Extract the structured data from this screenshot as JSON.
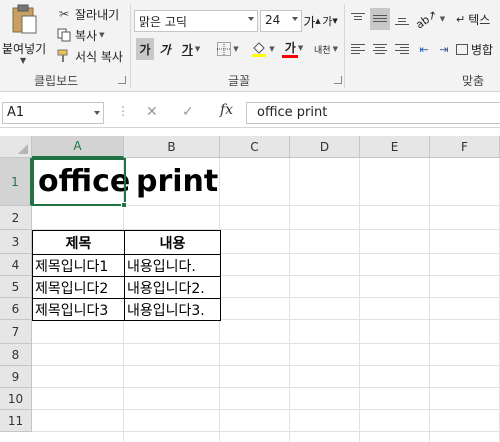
{
  "ribbon": {
    "clipboard": {
      "paste_label": "붙여넣기",
      "cut_label": "잘라내기",
      "copy_label": "복사",
      "format_painter_label": "서식 복사",
      "group_label": "클립보드"
    },
    "font": {
      "font_name": "맑은 고딕",
      "font_size": "24",
      "grow_label": "가",
      "shrink_label": "가",
      "bold_label": "가",
      "italic_label": "가",
      "underline_label": "가",
      "font_color_label": "가",
      "phonetic_label": "내천",
      "group_label": "글꼴",
      "fill_color": "#ffff00",
      "font_color": "#ff0000"
    },
    "alignment": {
      "group_label": "맞춤",
      "wrap_label": "텍스",
      "merge_label": "병합"
    }
  },
  "formula_bar": {
    "name_box": "A1",
    "fx_label": "fx",
    "value": "office print"
  },
  "sheet": {
    "columns": [
      "A",
      "B",
      "C",
      "D",
      "E",
      "F"
    ],
    "rows": [
      "1",
      "2",
      "3",
      "4",
      "5",
      "6",
      "7",
      "8",
      "9",
      "10",
      "11"
    ],
    "selected_cell": "A1",
    "cells": {
      "A1": "office",
      "B1": "print"
    },
    "table": {
      "headers": [
        "제목",
        "내용"
      ],
      "rows": [
        [
          "제목입니다1",
          "내용입니다."
        ],
        [
          "제목입니다2",
          "내용입니다2."
        ],
        [
          "제목입니다3",
          "내용입니다3."
        ]
      ]
    },
    "accent_color": "#217346"
  }
}
